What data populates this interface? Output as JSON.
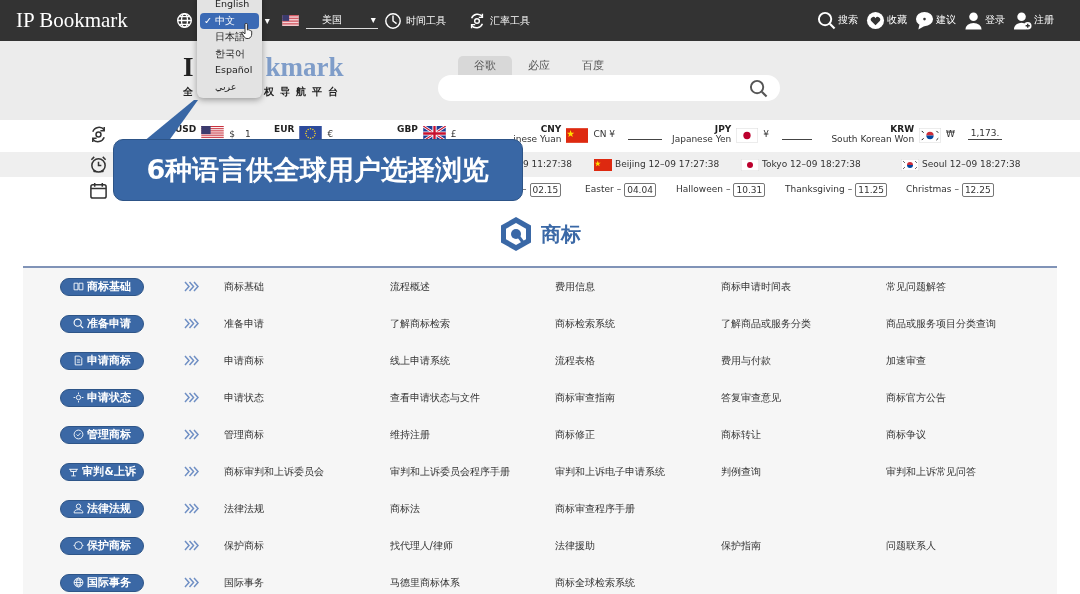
{
  "header": {
    "logo": "IP Bookmark",
    "language_caret": "▾",
    "country": {
      "value": "美国",
      "caret": "▾"
    },
    "tools": [
      {
        "label": "时间工具"
      },
      {
        "label": "汇率工具"
      }
    ],
    "actions": [
      {
        "label": "搜索"
      },
      {
        "label": "收藏"
      },
      {
        "label": "建议"
      },
      {
        "label": "登录"
      },
      {
        "label": "注册"
      }
    ]
  },
  "language_menu": {
    "check": "✓",
    "items": [
      {
        "label": "English",
        "selected": false
      },
      {
        "label": "中文",
        "selected": true
      },
      {
        "label": "日本語",
        "selected": false
      },
      {
        "label": "한국어",
        "selected": false
      },
      {
        "label": "Español",
        "selected": false
      },
      {
        "label": "عربي",
        "selected": false
      }
    ]
  },
  "site_logo": {
    "title_parts": [
      "I",
      "kmark"
    ],
    "tagline_parts": [
      "全",
      "权导航平台"
    ]
  },
  "search": {
    "engines": [
      {
        "label": "谷歌",
        "selected": true
      },
      {
        "label": "必应",
        "selected": false
      },
      {
        "label": "百度",
        "selected": false
      }
    ]
  },
  "currency_row": {
    "items": [
      {
        "code": "USD",
        "symbol": "$",
        "amount": "1"
      },
      {
        "code": "EUR",
        "symbol": "€"
      },
      {
        "code": "GBP",
        "symbol": "£"
      },
      {
        "code": "CNY",
        "name": "inese Yuan",
        "symbol": "CN ¥",
        "amount_field": true
      },
      {
        "code": "JPY",
        "name": "Japanese Yen",
        "symbol": "¥",
        "amount_field": true
      },
      {
        "code": "KRW",
        "name": "South Korean Won",
        "symbol": "₩",
        "amount_field": true,
        "amount": "1,173."
      }
    ]
  },
  "time_row": {
    "items": [
      {
        "text": "9 11:27:38"
      },
      {
        "text": "Beijing 12–09 17:27:38"
      },
      {
        "text": "Tokyo 12–09 18:27:38"
      },
      {
        "text": "Seoul 12–09 18:27:38"
      }
    ]
  },
  "holiday_row": {
    "items": [
      {
        "dash": "–",
        "date": "02.15"
      },
      {
        "name": "Easter",
        "dash": "–",
        "date": "04.04"
      },
      {
        "name": "Halloween",
        "dash": "–",
        "date": "10.31"
      },
      {
        "name": "Thanksgiving",
        "dash": "–",
        "date": "11.25"
      },
      {
        "name": "Christmas",
        "dash": "–",
        "date": "12.25"
      }
    ]
  },
  "callout": {
    "text": "6种语言供全球用户选择浏览"
  },
  "section": {
    "title": "商标",
    "categories": [
      {
        "label": "商标基础",
        "links": [
          "商标基础",
          "流程概述",
          "费用信息",
          "商标申请时间表",
          "常见问题解答"
        ]
      },
      {
        "label": "准备申请",
        "links": [
          "准备申请",
          "了解商标检索",
          "商标检索系统",
          "了解商品或服务分类",
          "商品或服务项目分类查询"
        ]
      },
      {
        "label": "申请商标",
        "links": [
          "申请商标",
          "线上申请系统",
          "流程表格",
          "费用与付款",
          "加速审查"
        ]
      },
      {
        "label": "申请状态",
        "links": [
          "申请状态",
          "查看申请状态与文件",
          "商标审查指南",
          "答复审查意见",
          "商标官方公告"
        ]
      },
      {
        "label": "管理商标",
        "links": [
          "管理商标",
          "维持注册",
          "商标修正",
          "商标转让",
          "商标争议"
        ]
      },
      {
        "label": "审判&上诉",
        "links": [
          "商标审判和上诉委员会",
          "审判和上诉委员会程序手册",
          "审判和上诉电子申请系统",
          "判例查询",
          "审判和上诉常见问答"
        ]
      },
      {
        "label": "法律法规",
        "links": [
          "法律法规",
          "商标法",
          "商标审查程序手册"
        ]
      },
      {
        "label": "保护商标",
        "links": [
          "保护商标",
          "找代理人/律师",
          "法律援助",
          "保护指南",
          "问题联系人"
        ]
      },
      {
        "label": "国际事务",
        "links": [
          "国际事务",
          "马德里商标体系",
          "商标全球检索系统"
        ]
      }
    ]
  }
}
